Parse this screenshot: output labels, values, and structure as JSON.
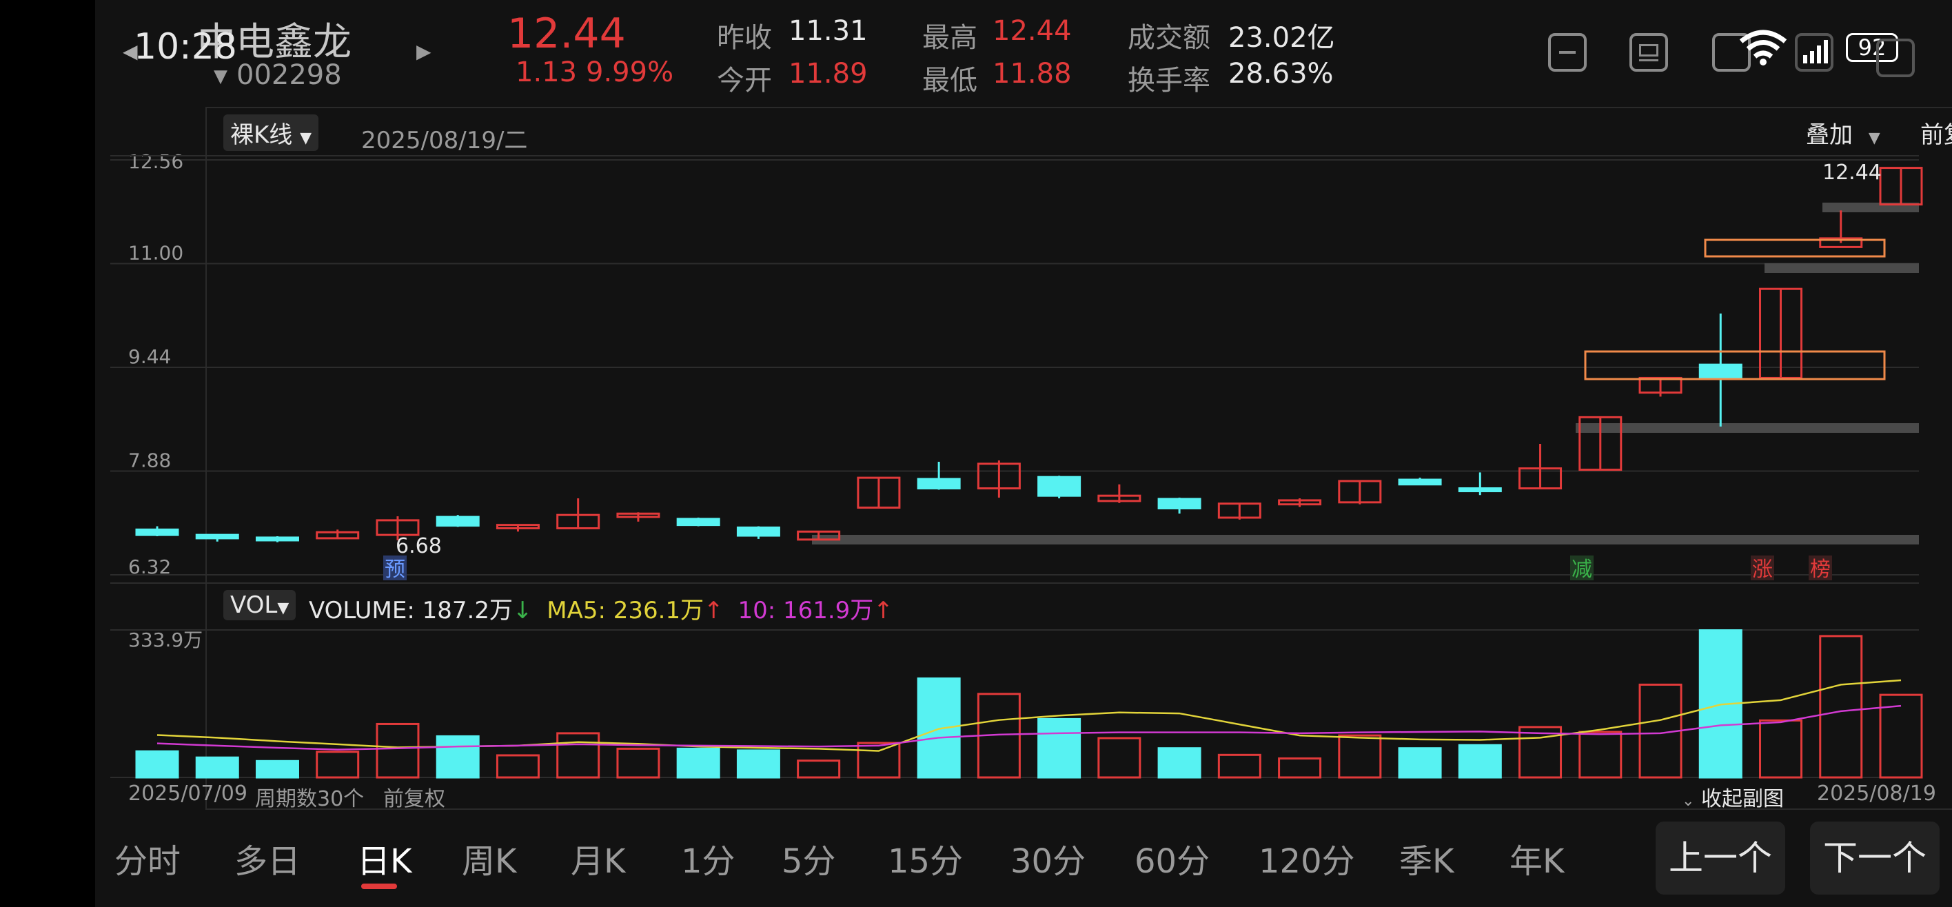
{
  "status": {
    "time": "10:28",
    "battery": "92"
  },
  "stock": {
    "name": "中电鑫龙",
    "code": "002298",
    "price": "12.44",
    "change": "1.13",
    "change_pct": "9.99%",
    "prev_close_label": "昨收",
    "prev_close": "11.31",
    "open_label": "今开",
    "open": "11.89",
    "high_label": "最高",
    "high": "12.44",
    "low_label": "最低",
    "low": "11.88",
    "turnover_label": "成交额",
    "turnover": "23.02亿",
    "turnover_rate_label": "换手率",
    "turnover_rate": "28.63%"
  },
  "chart_header": {
    "kline_type": "裸K线",
    "date": "2025/08/19/二",
    "overlay": "叠加",
    "adjust": "前复权"
  },
  "y_ticks": [
    "12.56",
    "11.00",
    "9.44",
    "7.88",
    "6.32"
  ],
  "labels": {
    "max_price": "12.44",
    "min_price": "6.68",
    "yu": "预",
    "jian": "减",
    "zhang": "涨",
    "bang": "榜"
  },
  "volume_header": {
    "selector": "VOL",
    "volume": "VOLUME: 187.2万",
    "volume_arrow": "↓",
    "ma5": "MA5: 236.1万",
    "ma5_arrow": "↑",
    "ma10": "10: 161.9万",
    "ma10_arrow": "↑",
    "max_label": "333.9万"
  },
  "footer": {
    "start_date": "2025/07/09",
    "period": "周期数30个",
    "adjust": "前复权",
    "collapse": "收起副图",
    "end_date": "2025/08/19"
  },
  "tabs": [
    "分时",
    "多日",
    "日K",
    "周K",
    "月K",
    "1分",
    "5分",
    "15分",
    "30分",
    "60分",
    "120分",
    "季K",
    "年K"
  ],
  "active_tab": "日K",
  "nav": {
    "prev": "上一个",
    "next": "下一个"
  },
  "colors": {
    "up": "#e23a3a",
    "down": "#57f2f2",
    "ma5": "#e2d43a",
    "ma10": "#d23ad2",
    "box": "#f08a4a"
  },
  "chart_data": {
    "type": "candlestick",
    "x": [
      "2025/07/09",
      "2025/08/19"
    ],
    "ylim": [
      6.32,
      12.56
    ],
    "candles": [
      {
        "o": 7.0,
        "c": 6.92,
        "h": 7.05,
        "l": 6.9
      },
      {
        "o": 6.92,
        "c": 6.87,
        "h": 6.93,
        "l": 6.82
      },
      {
        "o": 6.88,
        "c": 6.86,
        "h": 6.9,
        "l": 6.81
      },
      {
        "o": 6.87,
        "c": 6.96,
        "h": 7.0,
        "l": 6.86
      },
      {
        "o": 6.92,
        "c": 7.14,
        "h": 7.2,
        "l": 6.84
      },
      {
        "o": 7.19,
        "c": 7.06,
        "h": 7.22,
        "l": 7.04
      },
      {
        "o": 7.02,
        "c": 7.07,
        "h": 7.08,
        "l": 6.97
      },
      {
        "o": 7.02,
        "c": 7.22,
        "h": 7.47,
        "l": 7.02
      },
      {
        "o": 7.19,
        "c": 7.24,
        "h": 7.26,
        "l": 7.12
      },
      {
        "o": 7.16,
        "c": 7.07,
        "h": 7.18,
        "l": 7.05
      },
      {
        "o": 7.03,
        "c": 6.91,
        "h": 7.05,
        "l": 6.86
      },
      {
        "o": 6.85,
        "c": 6.97,
        "h": 6.97,
        "l": 6.85
      },
      {
        "o": 7.33,
        "c": 7.78,
        "h": 7.78,
        "l": 7.33
      },
      {
        "o": 7.76,
        "c": 7.62,
        "h": 8.02,
        "l": 7.6
      },
      {
        "o": 7.62,
        "c": 7.99,
        "h": 8.04,
        "l": 7.48
      },
      {
        "o": 7.79,
        "c": 7.51,
        "h": 7.81,
        "l": 7.47
      },
      {
        "o": 7.43,
        "c": 7.51,
        "h": 7.68,
        "l": 7.4
      },
      {
        "o": 7.46,
        "c": 7.32,
        "h": 7.48,
        "l": 7.24
      },
      {
        "o": 7.18,
        "c": 7.39,
        "h": 7.4,
        "l": 7.15
      },
      {
        "o": 7.38,
        "c": 7.44,
        "h": 7.47,
        "l": 7.34
      },
      {
        "o": 7.41,
        "c": 7.73,
        "h": 7.74,
        "l": 7.38
      },
      {
        "o": 7.75,
        "c": 7.68,
        "h": 7.78,
        "l": 7.67
      },
      {
        "o": 7.62,
        "c": 7.61,
        "h": 7.86,
        "l": 7.52
      },
      {
        "o": 7.62,
        "c": 7.92,
        "h": 8.29,
        "l": 7.62
      },
      {
        "o": 7.9,
        "c": 8.69,
        "h": 8.69,
        "l": 7.9
      },
      {
        "o": 9.06,
        "c": 9.28,
        "h": 9.28,
        "l": 9.0
      },
      {
        "o": 9.48,
        "c": 9.28,
        "h": 10.25,
        "l": 8.55
      },
      {
        "o": 9.28,
        "c": 10.62,
        "h": 10.63,
        "l": 9.28
      },
      {
        "o": 11.25,
        "c": 11.38,
        "h": 11.8,
        "l": 11.31
      },
      {
        "o": 11.89,
        "c": 12.44,
        "h": 12.44,
        "l": 11.88
      }
    ],
    "volume": [
      59,
      45,
      37,
      58,
      121,
      93,
      50,
      100,
      65,
      65,
      61,
      38,
      78,
      224,
      189,
      132,
      89,
      66,
      51,
      43,
      95,
      66,
      73,
      114,
      103,
      210,
      333,
      129,
      320,
      187
    ],
    "ma5": [
      96,
      90,
      82,
      75,
      68,
      70,
      72,
      80,
      76,
      70,
      67,
      65,
      60,
      110,
      130,
      140,
      147,
      145,
      120,
      95,
      90,
      86,
      85,
      90,
      108,
      130,
      165,
      175,
      210,
      220
    ],
    "ma10": [
      77,
      72,
      67,
      63,
      66,
      70,
      72,
      75,
      73,
      72,
      71,
      70,
      72,
      90,
      97,
      100,
      102,
      102,
      102,
      100,
      102,
      103,
      104,
      100,
      98,
      100,
      118,
      125,
      150,
      162
    ],
    "vol_max": 333.9
  }
}
